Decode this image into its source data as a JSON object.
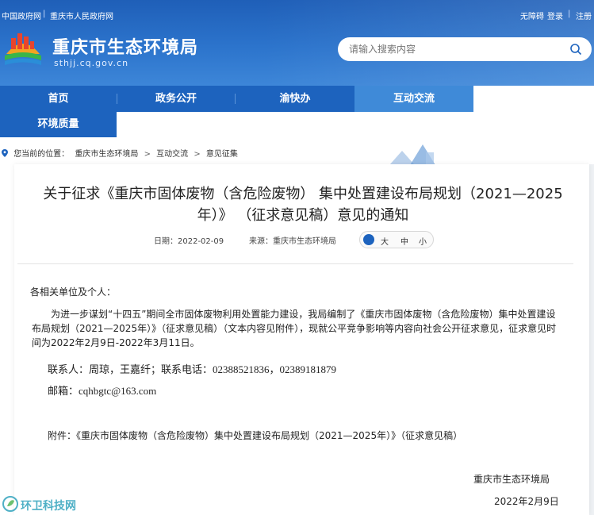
{
  "topbar": {
    "links_left": [
      "中国政府网",
      "重庆市人民政府网"
    ],
    "links_right": [
      "无障碍",
      "登录",
      "注册"
    ]
  },
  "site": {
    "title": "重庆市生态环境局",
    "url": "sthjj.cq.gov.cn"
  },
  "search": {
    "placeholder": "请输入搜索内容"
  },
  "nav": {
    "items": [
      "首页",
      "政务公开",
      "渝快办",
      "互动交流",
      "环境质量"
    ]
  },
  "breadcrumb": {
    "prefix": "您当前的位置：",
    "items": [
      "重庆市生态环境局",
      "互动交流",
      "意见征集"
    ]
  },
  "article": {
    "title": "关于征求《重庆市固体废物（含危险废物） 集中处置建设布局规划（2021—2025年）》 （征求意见稿）意见的通知",
    "date_label": "日期：2022-02-09",
    "source_label": "来源：重庆市生态环境局",
    "font_size_options": [
      "大",
      "中",
      "小"
    ],
    "salutation": "各相关单位及个人：",
    "paragraph": "为进一步谋划“十四五”期间全市固体废物利用处置能力建设，我局编制了《重庆市固体废物（含危险废物）集中处置建设布局规划（2021—2025年）》（征求意见稿）（文本内容见附件），现就公平竞争影响等内容向社会公开征求意见，征求意见时间为2022年2月9日-2022年3月11日。",
    "contact": "联系人：周琼，王嘉纤；联系电话：02388521836，02389181879",
    "email": "邮箱：cqhbgtc@163.com",
    "attachment": "附件：《重庆市固体废物（含危险废物）集中处置建设布局规划（2021—2025年）》（征求意见稿）",
    "signature": "重庆市生态环境局",
    "sign_date": "2022年2月9日"
  },
  "watermark": {
    "text": "环卫科技网"
  },
  "colors": {
    "header_blue": "#1f5fb8",
    "nav_blue": "#1d63be",
    "nav_active": "#3f8ad8",
    "watermark": "#4fb0c6"
  }
}
